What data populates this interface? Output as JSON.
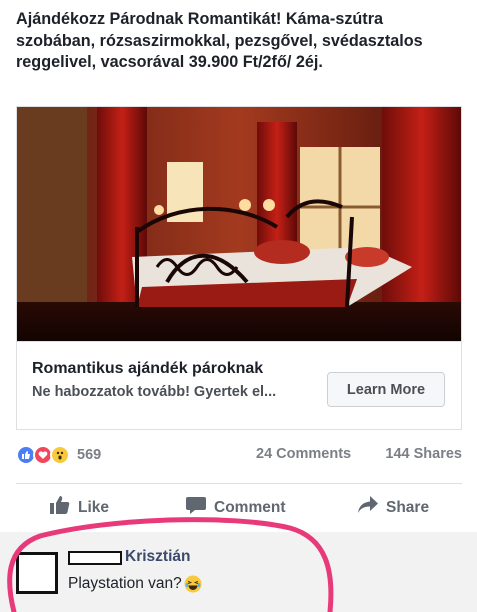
{
  "post": {
    "text": "Ajándékozz Párodnak Romantikát! Káma-szútra szobában, rózsaszirmokkal, pezsgővel, svédasztalos reggelivel, vacsorával 39.900 Ft/2fő/ 2éj."
  },
  "link": {
    "title": "Romantikus ajándék pároknak",
    "description": "Ne habozzatok tovább! Gyertek el...",
    "button_label": "Learn More"
  },
  "stats": {
    "reaction_count": "569",
    "comments": "24 Comments",
    "shares": "144 Shares",
    "reaction_icons": [
      "like-icon",
      "love-icon",
      "wow-icon"
    ]
  },
  "actions": {
    "like": "Like",
    "comment": "Comment",
    "share": "Share"
  },
  "comment": {
    "author": "Krisztián",
    "text": "Playstation van?",
    "emoji": "laughing-emoji"
  },
  "colors": {
    "accent_circle": "#e83a7a",
    "like": "#4a7ef2",
    "love": "#f0475a",
    "wow": "#f8c93c"
  }
}
